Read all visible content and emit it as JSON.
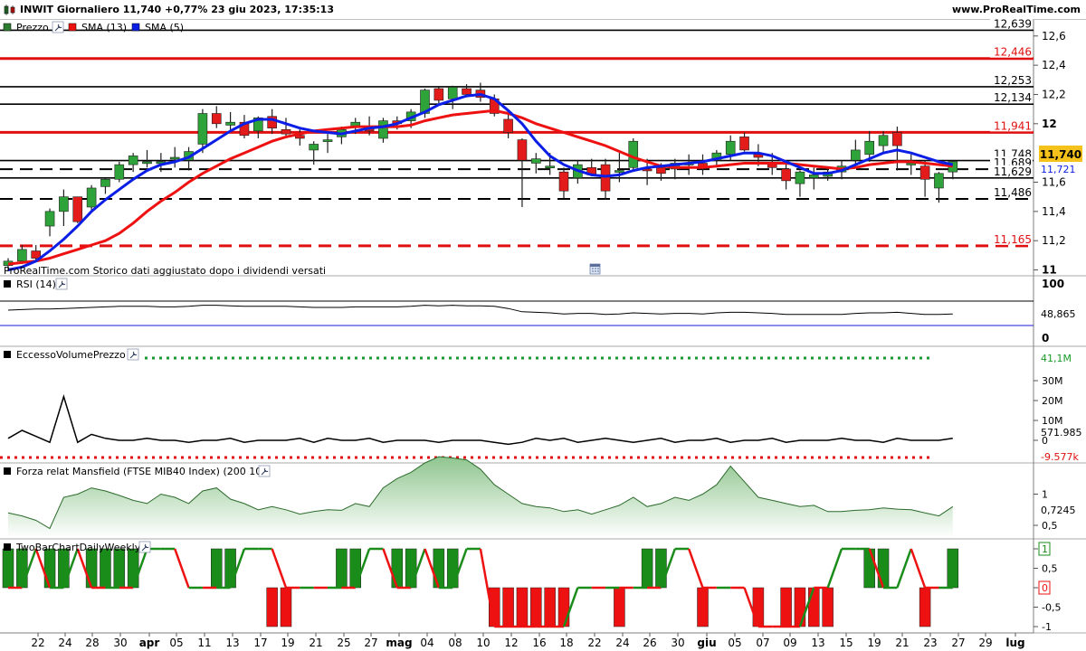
{
  "header": {
    "title": "INWIT Giornaliero 11,740 +0,77% 23 giu 2023, 17:35:13",
    "brand": "www.ProRealTime.com"
  },
  "price_panel": {
    "legend": [
      {
        "label": "Prezzo",
        "color": "#2e7d32"
      },
      {
        "label": "SMA (13)",
        "color": "#ee1111"
      },
      {
        "label": "SMA (5)",
        "color": "#0a1ee6"
      }
    ],
    "note": "ProRealTime.com  Storico dati aggiustato dopo i dividendi versati",
    "axis_ticks": [
      {
        "v": 12.6,
        "t": "12,6"
      },
      {
        "v": 12.4,
        "t": "12,4"
      },
      {
        "v": 12.2,
        "t": "12,2"
      },
      {
        "v": 12.0,
        "t": "12"
      },
      {
        "v": 11.6,
        "t": "11,6"
      },
      {
        "v": 11.4,
        "t": "11,4"
      },
      {
        "v": 11.2,
        "t": "11,2"
      },
      {
        "v": 11.0,
        "t": "11"
      }
    ],
    "levels": [
      {
        "v": 12.639,
        "label": "12,639",
        "color": "#000000",
        "style": "solid"
      },
      {
        "v": 12.446,
        "label": "12,446",
        "color": "#e01010",
        "style": "solid"
      },
      {
        "v": 12.253,
        "label": "12,253",
        "color": "#000000",
        "style": "solid"
      },
      {
        "v": 12.134,
        "label": "12,134",
        "color": "#000000",
        "style": "solid"
      },
      {
        "v": 11.941,
        "label": "11,941",
        "color": "#e01010",
        "style": "solid"
      },
      {
        "v": 11.748,
        "label": "11,748",
        "color": "#000000",
        "style": "solid"
      },
      {
        "v": 11.689,
        "label": "11,689",
        "color": "#000000",
        "style": "dashed"
      },
      {
        "v": 11.629,
        "label": "11,629",
        "color": "#000000",
        "style": "solid"
      },
      {
        "v": 11.486,
        "label": "11,486",
        "color": "#000000",
        "style": "dashed"
      },
      {
        "v": 11.165,
        "label": "11,165",
        "color": "#e01010",
        "style": "dashed"
      }
    ],
    "last_price": "11,740",
    "sma5_last": "11,721"
  },
  "rsi_panel": {
    "label": "RSI (14)",
    "axis_top": "100",
    "axis_bottom": "0",
    "value": "48,865"
  },
  "volume_panel": {
    "label": "EccessoVolumePrezzo",
    "upper": "41,1M",
    "ticks": [
      {
        "v": 30,
        "t": "30M"
      },
      {
        "v": 20,
        "t": "20M"
      },
      {
        "v": 10,
        "t": "10M"
      },
      {
        "v": 0,
        "t": "0"
      }
    ],
    "value": "571.985",
    "lower": "-9.577k"
  },
  "mansfield_panel": {
    "label": "Forza relat Mansfield (FTSE MIB40 Index) (200 10)",
    "ticks": [
      {
        "v": 1.0,
        "t": "1"
      },
      {
        "v": 0.5,
        "t": "0,5"
      }
    ],
    "value": "0,7245"
  },
  "twobar_panel": {
    "label": "TwoBarChartDailyWeekly",
    "ticks": [
      {
        "v": 1,
        "t": "1"
      },
      {
        "v": 0.5,
        "t": "0,5"
      },
      {
        "v": 0,
        "t": "0"
      },
      {
        "v": -0.5,
        "t": "-0,5"
      },
      {
        "v": -1,
        "t": "-1"
      }
    ]
  },
  "x_axis": {
    "labels": [
      {
        "x": 42,
        "t": "22"
      },
      {
        "x": 72,
        "t": "24"
      },
      {
        "x": 102,
        "t": "28"
      },
      {
        "x": 133,
        "t": "30"
      },
      {
        "x": 165,
        "t": "apr",
        "bold": true
      },
      {
        "x": 195,
        "t": "05"
      },
      {
        "x": 226,
        "t": "11"
      },
      {
        "x": 257,
        "t": "13"
      },
      {
        "x": 288,
        "t": "17"
      },
      {
        "x": 318,
        "t": "19"
      },
      {
        "x": 349,
        "t": "21"
      },
      {
        "x": 380,
        "t": "25"
      },
      {
        "x": 410,
        "t": "27"
      },
      {
        "x": 441,
        "t": "mag",
        "bold": true
      },
      {
        "x": 472,
        "t": "04"
      },
      {
        "x": 503,
        "t": "08"
      },
      {
        "x": 534,
        "t": "10"
      },
      {
        "x": 565,
        "t": "12"
      },
      {
        "x": 596,
        "t": "16"
      },
      {
        "x": 626,
        "t": "18"
      },
      {
        "x": 657,
        "t": "22"
      },
      {
        "x": 688,
        "t": "24"
      },
      {
        "x": 718,
        "t": "26"
      },
      {
        "x": 749,
        "t": "30"
      },
      {
        "x": 781,
        "t": "giu",
        "bold": true
      },
      {
        "x": 812,
        "t": "05"
      },
      {
        "x": 843,
        "t": "07"
      },
      {
        "x": 873,
        "t": "09"
      },
      {
        "x": 904,
        "t": "13"
      },
      {
        "x": 935,
        "t": "15"
      },
      {
        "x": 966,
        "t": "19"
      },
      {
        "x": 997,
        "t": "21"
      },
      {
        "x": 1028,
        "t": "23"
      },
      {
        "x": 1059,
        "t": "27"
      },
      {
        "x": 1089,
        "t": "29"
      },
      {
        "x": 1122,
        "t": "lug",
        "bold": true
      }
    ]
  },
  "chart_data": {
    "type": "candlestick",
    "x_start_label": "21",
    "candles": [
      [
        11.03,
        11.08,
        10.99,
        11.06
      ],
      [
        11.06,
        11.17,
        11.04,
        11.14
      ],
      [
        11.13,
        11.17,
        11.06,
        11.08
      ],
      [
        11.3,
        11.42,
        11.23,
        11.4
      ],
      [
        11.4,
        11.55,
        11.3,
        11.5
      ],
      [
        11.5,
        11.5,
        11.32,
        11.33
      ],
      [
        11.43,
        11.58,
        11.4,
        11.56
      ],
      [
        11.57,
        11.63,
        11.52,
        11.62
      ],
      [
        11.62,
        11.74,
        11.6,
        11.72
      ],
      [
        11.72,
        11.8,
        11.67,
        11.78
      ],
      [
        11.74,
        11.82,
        11.7,
        11.74
      ],
      [
        11.73,
        11.8,
        11.67,
        11.74
      ],
      [
        11.76,
        11.84,
        11.7,
        11.77
      ],
      [
        11.75,
        11.84,
        11.68,
        11.81
      ],
      [
        11.86,
        12.1,
        11.8,
        12.07
      ],
      [
        12.07,
        12.12,
        11.97,
        12.0
      ],
      [
        11.99,
        12.08,
        11.95,
        12.01
      ],
      [
        12.01,
        12.06,
        11.9,
        11.92
      ],
      [
        11.95,
        12.05,
        11.9,
        12.04
      ],
      [
        12.05,
        12.1,
        11.93,
        11.97
      ],
      [
        11.96,
        12.04,
        11.9,
        11.93
      ],
      [
        11.92,
        11.96,
        11.85,
        11.9
      ],
      [
        11.82,
        11.88,
        11.72,
        11.86
      ],
      [
        11.88,
        11.93,
        11.8,
        11.89
      ],
      [
        11.91,
        11.98,
        11.86,
        11.96
      ],
      [
        11.98,
        12.04,
        11.93,
        12.01
      ],
      [
        11.98,
        12.05,
        11.92,
        11.95
      ],
      [
        11.9,
        12.04,
        11.87,
        12.02
      ],
      [
        12.02,
        12.05,
        11.96,
        12.0
      ],
      [
        12.02,
        12.1,
        11.97,
        12.08
      ],
      [
        12.07,
        12.24,
        12.04,
        12.23
      ],
      [
        12.24,
        12.25,
        12.14,
        12.16
      ],
      [
        12.17,
        12.26,
        12.1,
        12.25
      ],
      [
        12.24,
        12.27,
        12.18,
        12.2
      ],
      [
        12.23,
        12.28,
        12.15,
        12.18
      ],
      [
        12.17,
        12.2,
        12.05,
        12.07
      ],
      [
        12.03,
        12.07,
        11.9,
        11.94
      ],
      [
        11.89,
        11.9,
        11.43,
        11.75
      ],
      [
        11.73,
        11.8,
        11.66,
        11.76
      ],
      [
        11.7,
        11.8,
        11.65,
        11.71
      ],
      [
        11.67,
        11.7,
        11.49,
        11.54
      ],
      [
        11.63,
        11.75,
        11.59,
        11.72
      ],
      [
        11.7,
        11.76,
        11.64,
        11.65
      ],
      [
        11.72,
        11.76,
        11.48,
        11.54
      ],
      [
        11.67,
        11.8,
        11.6,
        11.68
      ],
      [
        11.7,
        11.9,
        11.67,
        11.88
      ],
      [
        11.69,
        11.76,
        11.58,
        11.68
      ],
      [
        11.7,
        11.73,
        11.61,
        11.66
      ],
      [
        11.69,
        11.76,
        11.62,
        11.73
      ],
      [
        11.72,
        11.79,
        11.65,
        11.73
      ],
      [
        11.73,
        11.79,
        11.65,
        11.7
      ],
      [
        11.75,
        11.82,
        11.7,
        11.8
      ],
      [
        11.79,
        11.92,
        11.75,
        11.88
      ],
      [
        11.91,
        11.94,
        11.81,
        11.82
      ],
      [
        11.79,
        11.86,
        11.71,
        11.77
      ],
      [
        11.73,
        11.8,
        11.65,
        11.7
      ],
      [
        11.69,
        11.75,
        11.55,
        11.61
      ],
      [
        11.59,
        11.68,
        11.5,
        11.67
      ],
      [
        11.63,
        11.7,
        11.55,
        11.65
      ],
      [
        11.64,
        11.7,
        11.61,
        11.67
      ],
      [
        11.67,
        11.75,
        11.62,
        11.71
      ],
      [
        11.75,
        11.89,
        11.7,
        11.82
      ],
      [
        11.79,
        11.95,
        11.74,
        11.88
      ],
      [
        11.85,
        11.95,
        11.8,
        11.92
      ],
      [
        11.94,
        11.98,
        11.68,
        11.85
      ],
      [
        11.73,
        11.79,
        11.65,
        11.73
      ],
      [
        11.71,
        11.75,
        11.5,
        11.62
      ],
      [
        11.56,
        11.67,
        11.46,
        11.66
      ],
      [
        11.67,
        11.75,
        11.62,
        11.74
      ]
    ],
    "sma13": [
      11.04,
      11.05,
      11.06,
      11.08,
      11.11,
      11.14,
      11.17,
      11.2,
      11.25,
      11.32,
      11.4,
      11.47,
      11.53,
      11.6,
      11.66,
      11.71,
      11.76,
      11.8,
      11.84,
      11.88,
      11.91,
      11.93,
      11.95,
      11.96,
      11.97,
      11.98,
      11.98,
      11.98,
      11.98,
      11.99,
      12.02,
      12.04,
      12.06,
      12.07,
      12.08,
      12.09,
      12.07,
      12.04,
      12.0,
      11.97,
      11.94,
      11.91,
      11.88,
      11.85,
      11.81,
      11.77,
      11.74,
      11.71,
      11.7,
      11.7,
      11.7,
      11.71,
      11.72,
      11.73,
      11.73,
      11.73,
      11.73,
      11.72,
      11.71,
      11.7,
      11.69,
      11.7,
      11.72,
      11.73,
      11.74,
      11.74,
      11.73,
      11.72,
      11.71
    ],
    "sma5": [
      11.0,
      11.02,
      11.06,
      11.13,
      11.21,
      11.3,
      11.4,
      11.48,
      11.55,
      11.62,
      11.68,
      11.72,
      11.74,
      11.77,
      11.83,
      11.89,
      11.95,
      12.0,
      12.03,
      12.03,
      12.0,
      11.97,
      11.95,
      11.94,
      11.93,
      11.95,
      11.97,
      11.98,
      12.0,
      12.04,
      12.08,
      12.13,
      12.16,
      12.19,
      12.2,
      12.17,
      12.09,
      12.0,
      11.88,
      11.78,
      11.72,
      11.68,
      11.65,
      11.64,
      11.65,
      11.68,
      11.7,
      11.71,
      11.72,
      11.73,
      11.74,
      11.76,
      11.78,
      11.8,
      11.8,
      11.78,
      11.74,
      11.7,
      11.66,
      11.66,
      11.68,
      11.72,
      11.76,
      11.8,
      11.82,
      11.8,
      11.77,
      11.74,
      11.72
    ],
    "rsi": [
      55,
      56,
      57,
      57,
      58,
      59,
      60,
      61,
      62,
      62,
      62,
      61,
      61,
      62,
      64,
      64,
      63,
      62,
      62,
      62,
      62,
      61,
      60,
      60,
      60,
      61,
      61,
      61,
      61,
      62,
      64,
      63,
      64,
      63,
      63,
      62,
      58,
      52,
      51,
      50,
      48,
      49,
      49,
      47,
      48,
      50,
      49,
      48,
      49,
      49,
      48,
      50,
      51,
      51,
      50,
      49,
      47,
      47,
      47,
      47,
      47,
      49,
      50,
      50,
      51,
      49,
      47,
      47,
      48
    ],
    "volume_excess": [
      1,
      5,
      2,
      -1,
      22,
      -1,
      3,
      1,
      0,
      0,
      1,
      0,
      0,
      -1,
      0,
      0,
      1,
      -1,
      0,
      0,
      0,
      1,
      -1,
      1,
      0,
      0,
      1,
      -1,
      0,
      0,
      0,
      -1,
      0,
      0,
      0,
      -1,
      -2,
      -1,
      1,
      0,
      1,
      -1,
      0,
      1,
      0,
      -1,
      0,
      1,
      -1,
      0,
      0,
      1,
      -1,
      0,
      0,
      1,
      -1,
      0,
      0,
      0,
      1,
      0,
      0,
      -1,
      1,
      0,
      0,
      0,
      1
    ],
    "mansfield": [
      0.7,
      0.65,
      0.58,
      0.45,
      0.95,
      1.0,
      1.1,
      1.05,
      0.98,
      0.9,
      0.85,
      1.0,
      0.95,
      0.85,
      1.05,
      1.1,
      0.92,
      0.85,
      0.75,
      0.8,
      0.75,
      0.68,
      0.72,
      0.75,
      0.74,
      0.85,
      0.8,
      1.1,
      1.25,
      1.35,
      1.5,
      1.6,
      1.58,
      1.55,
      1.4,
      1.15,
      1.0,
      0.85,
      0.8,
      0.78,
      0.72,
      0.75,
      0.68,
      0.75,
      0.82,
      0.95,
      0.8,
      0.85,
      0.95,
      0.9,
      1.0,
      1.15,
      1.45,
      1.2,
      0.95,
      0.9,
      0.85,
      0.8,
      0.82,
      0.72,
      0.72,
      0.74,
      0.75,
      0.78,
      0.76,
      0.75,
      0.7,
      0.65,
      0.8
    ],
    "twobar": [
      1,
      1,
      0,
      1,
      1,
      0,
      1,
      1,
      1,
      1,
      0,
      0,
      0,
      0,
      0,
      1,
      1,
      0,
      0,
      -1,
      -1,
      0,
      0,
      0,
      1,
      1,
      0,
      0,
      1,
      1,
      0,
      1,
      1,
      0,
      0,
      -1,
      -1,
      -1,
      -1,
      -1,
      -1,
      0,
      0,
      0,
      -1,
      0,
      1,
      1,
      0,
      0,
      -1,
      0,
      0,
      0,
      -1,
      0,
      -1,
      -1,
      -1,
      -1,
      0,
      0,
      1,
      1,
      0,
      0,
      -1,
      0,
      1
    ],
    "twobar_line": [
      0,
      0,
      1,
      0,
      0,
      1,
      0,
      0,
      0,
      0,
      1,
      1,
      1,
      0,
      0,
      0,
      0,
      1,
      1,
      1,
      0,
      0,
      0,
      0,
      0,
      0,
      1,
      1,
      0,
      0,
      1,
      0,
      0,
      1,
      1,
      -1,
      -1,
      -1,
      -1,
      -1,
      -1,
      0,
      0,
      0,
      0,
      0,
      0,
      0,
      1,
      1,
      0,
      0,
      0,
      0,
      -1,
      -1,
      -1,
      -1,
      0,
      0,
      1,
      1,
      1,
      0,
      0,
      1,
      0,
      0,
      0
    ],
    "ylim": [
      10.96,
      12.71
    ]
  }
}
